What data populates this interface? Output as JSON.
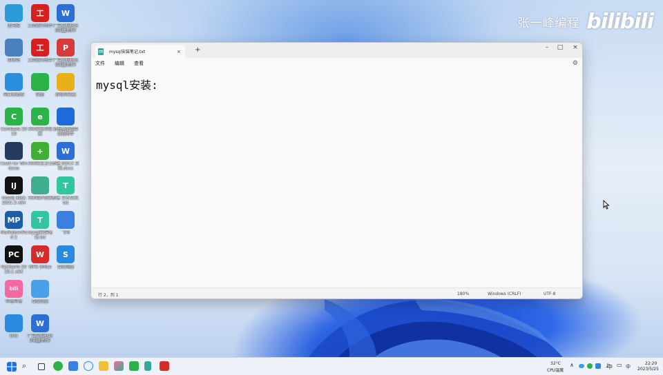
{
  "watermark": {
    "author": "张一峰编程",
    "logo": "bilibili"
  },
  "desktop_icons": [
    {
      "label": "此电脑",
      "color": "#2a9bd8",
      "glyph": ""
    },
    {
      "label": "工商银行助手",
      "color": "#d62020",
      "glyph": "工"
    },
    {
      "label": "广告文档标记 的规划制作说...",
      "color": "#2b6fd6",
      "glyph": "W"
    },
    {
      "label": "回收站",
      "color": "#4a7fc0",
      "glyph": ""
    },
    {
      "label": "工商银行助手",
      "color": "#d62020",
      "glyph": "工"
    },
    {
      "label": "广告文档标记 的规划制作说...",
      "color": "#d63a3a",
      "glyph": "P"
    },
    {
      "label": "向日葵远控",
      "color": "#2b8ee0",
      "glyph": ""
    },
    {
      "label": "微信",
      "color": "#2bb34a",
      "glyph": ""
    },
    {
      "label": "谷歌浏览器",
      "color": "#e8b019",
      "glyph": ""
    },
    {
      "label": "Camtasia 2019",
      "color": "#2bb34a",
      "glyph": "C"
    },
    {
      "label": "360安全浏览器",
      "color": "#2bb34a",
      "glyph": "e"
    },
    {
      "label": "远程桌面连接 设置助手",
      "color": "#1f6ad6",
      "glyph": ""
    },
    {
      "label": "Clash for Windows",
      "color": "#223b5e",
      "glyph": ""
    },
    {
      "label": "360安全卫士",
      "color": "#3fb034",
      "glyph": "+"
    },
    {
      "label": "新建 DOCX 文档.docx",
      "color": "#2b6fd6",
      "glyph": "W"
    },
    {
      "label": "IntelliJ IDEA 2021.3 x64",
      "color": "#111111",
      "glyph": "IJ"
    },
    {
      "label": "360软件管家",
      "color": "#3fae8e",
      "glyph": ""
    },
    {
      "label": "新建 文本文档.txt",
      "color": "#33c4a0",
      "glyph": "T"
    },
    {
      "label": "MarkdownPad 2",
      "color": "#1c5fa8",
      "glyph": "MP"
    },
    {
      "label": "mysql安装笔记.txt",
      "color": "#33c4a0",
      "glyph": "T"
    },
    {
      "label": "飞书",
      "color": "#3b7fe0",
      "glyph": ""
    },
    {
      "label": "PyCharm 2020.1 x64",
      "color": "#111111",
      "glyph": "PC"
    },
    {
      "label": "WPS Office",
      "color": "#d62b2b",
      "glyph": "W"
    },
    {
      "label": "百度网盘",
      "color": "#2a8ae0",
      "glyph": "S"
    },
    {
      "label": "哔哩哔哩",
      "color": "#f46aa0",
      "glyph": "bili"
    },
    {
      "label": "百度网盘",
      "color": "#4aa0e8",
      "glyph": ""
    },
    {
      "label": "钉钉",
      "color": "#2a8ae0",
      "glyph": ""
    },
    {
      "label": "广告文档标记 的规划制作说...",
      "color": "#2b6fd6",
      "glyph": "W"
    }
  ],
  "notepad": {
    "tab_title": "mysql安装笔记.txt",
    "tab_close": "×",
    "new_tab": "+",
    "win_minimize": "–",
    "win_maximize": "□",
    "win_close": "×",
    "menu": [
      "文件",
      "编辑",
      "查看"
    ],
    "settings_icon": "gear-icon",
    "content": "mysql安装:",
    "status": {
      "position": "行 2，列 1",
      "zoom": "180%",
      "line_ending": "Windows (CRLF)",
      "encoding": "UTF-8"
    }
  },
  "taskbar": {
    "weather_temp": "32°C",
    "weather_label": "CPU温度",
    "ime": "中",
    "ime2": "中",
    "time": "22:20",
    "date": "2023/5/25"
  }
}
